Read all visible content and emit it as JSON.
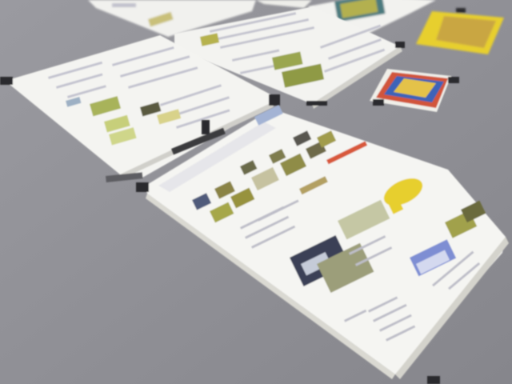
{
  "scene": {
    "description_visible_text": "",
    "colors": {
      "table": "#8e8e93",
      "table_shadow": "#7c7c82",
      "paper": "#f4f4f1",
      "paper_edge": "#d9d8d2",
      "tape": "#2b2b2e",
      "photo_green": "#9aa64f",
      "photo_dark": "#3a4157",
      "text_gray": "#b9b9c4",
      "accent_yellow": "#e7cf2d",
      "accent_red": "#d8583b",
      "accent_blue": "#7e8ed3"
    }
  }
}
